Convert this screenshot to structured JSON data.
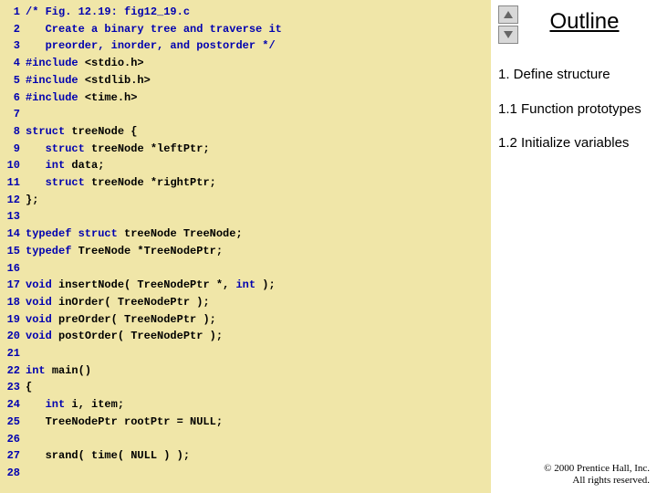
{
  "code": {
    "lines": [
      {
        "n": "1",
        "segs": [
          {
            "c": "cmt",
            "t": "/* Fig. 12.19: fig12_19.c"
          }
        ]
      },
      {
        "n": "2",
        "segs": [
          {
            "c": "cmt",
            "t": "   Create a binary tree and traverse it"
          }
        ]
      },
      {
        "n": "3",
        "segs": [
          {
            "c": "cmt",
            "t": "   preorder, inorder, and postorder */"
          }
        ]
      },
      {
        "n": "4",
        "segs": [
          {
            "c": "kw",
            "t": "#include "
          },
          {
            "c": "pl",
            "t": "<stdio.h>"
          }
        ]
      },
      {
        "n": "5",
        "segs": [
          {
            "c": "kw",
            "t": "#include "
          },
          {
            "c": "pl",
            "t": "<stdlib.h>"
          }
        ]
      },
      {
        "n": "6",
        "segs": [
          {
            "c": "kw",
            "t": "#include "
          },
          {
            "c": "pl",
            "t": "<time.h>"
          }
        ]
      },
      {
        "n": "7",
        "segs": []
      },
      {
        "n": "8",
        "segs": [
          {
            "c": "kw",
            "t": "struct "
          },
          {
            "c": "pl",
            "t": "treeNode {"
          }
        ]
      },
      {
        "n": "9",
        "segs": [
          {
            "c": "pl",
            "t": "   "
          },
          {
            "c": "kw",
            "t": "struct "
          },
          {
            "c": "pl",
            "t": "treeNode *leftPtr;"
          }
        ]
      },
      {
        "n": "10",
        "segs": [
          {
            "c": "pl",
            "t": "   "
          },
          {
            "c": "kw",
            "t": "int "
          },
          {
            "c": "pl",
            "t": "data;"
          }
        ]
      },
      {
        "n": "11",
        "segs": [
          {
            "c": "pl",
            "t": "   "
          },
          {
            "c": "kw",
            "t": "struct "
          },
          {
            "c": "pl",
            "t": "treeNode *rightPtr;"
          }
        ]
      },
      {
        "n": "12",
        "segs": [
          {
            "c": "pl",
            "t": "};"
          }
        ]
      },
      {
        "n": "13",
        "segs": []
      },
      {
        "n": "14",
        "segs": [
          {
            "c": "kw",
            "t": "typedef struct "
          },
          {
            "c": "pl",
            "t": "treeNode TreeNode;"
          }
        ]
      },
      {
        "n": "15",
        "segs": [
          {
            "c": "kw",
            "t": "typedef "
          },
          {
            "c": "pl",
            "t": "TreeNode *TreeNodePtr;"
          }
        ]
      },
      {
        "n": "16",
        "segs": []
      },
      {
        "n": "17",
        "segs": [
          {
            "c": "kw",
            "t": "void "
          },
          {
            "c": "pl",
            "t": "insertNode( TreeNodePtr *, "
          },
          {
            "c": "kw",
            "t": "int"
          },
          {
            "c": "pl",
            "t": " );"
          }
        ]
      },
      {
        "n": "18",
        "segs": [
          {
            "c": "kw",
            "t": "void "
          },
          {
            "c": "pl",
            "t": "inOrder( TreeNodePtr );"
          }
        ]
      },
      {
        "n": "19",
        "segs": [
          {
            "c": "kw",
            "t": "void "
          },
          {
            "c": "pl",
            "t": "preOrder( TreeNodePtr );"
          }
        ]
      },
      {
        "n": "20",
        "segs": [
          {
            "c": "kw",
            "t": "void "
          },
          {
            "c": "pl",
            "t": "postOrder( TreeNodePtr );"
          }
        ]
      },
      {
        "n": "21",
        "segs": []
      },
      {
        "n": "22",
        "segs": [
          {
            "c": "kw",
            "t": "int "
          },
          {
            "c": "pl",
            "t": "main()"
          }
        ]
      },
      {
        "n": "23",
        "segs": [
          {
            "c": "pl",
            "t": "{"
          }
        ]
      },
      {
        "n": "24",
        "segs": [
          {
            "c": "pl",
            "t": "   "
          },
          {
            "c": "kw",
            "t": "int "
          },
          {
            "c": "pl",
            "t": "i, item;"
          }
        ]
      },
      {
        "n": "25",
        "segs": [
          {
            "c": "pl",
            "t": "   TreeNodePtr rootPtr = NULL;"
          }
        ]
      },
      {
        "n": "26",
        "segs": []
      },
      {
        "n": "27",
        "segs": [
          {
            "c": "pl",
            "t": "   srand( time( NULL ) );"
          }
        ]
      },
      {
        "n": "28",
        "segs": []
      }
    ]
  },
  "outline": {
    "title": "Outline",
    "sections": [
      "1. Define structure",
      "1.1 Function prototypes",
      "1.2 Initialize variables"
    ]
  },
  "footer": {
    "line1": "© 2000 Prentice Hall, Inc.",
    "line2": "All rights reserved."
  }
}
